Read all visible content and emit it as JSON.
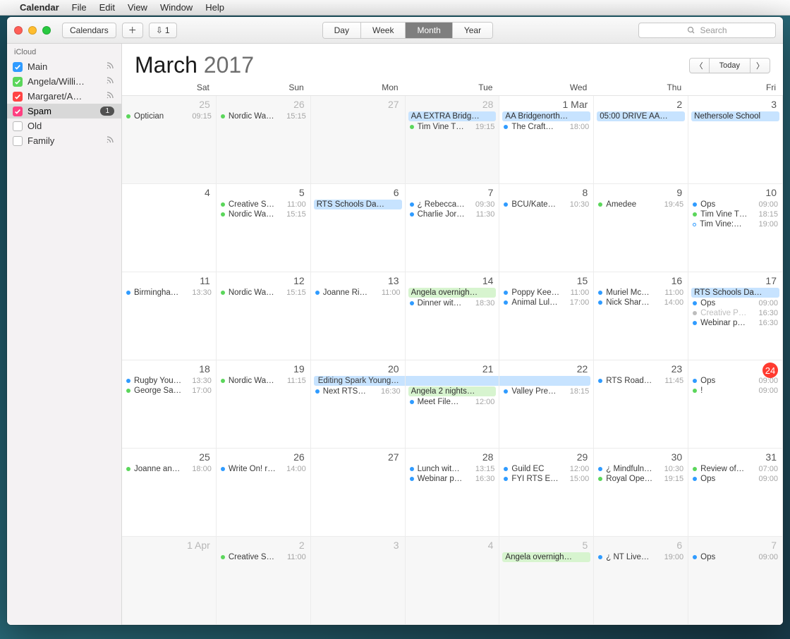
{
  "menubar": {
    "appname": "Calendar",
    "items": [
      "File",
      "Edit",
      "View",
      "Window",
      "Help"
    ]
  },
  "toolbar": {
    "calendars_label": "Calendars",
    "inbox_count": "1",
    "views": [
      "Day",
      "Week",
      "Month",
      "Year"
    ],
    "active_view": "Month",
    "search_placeholder": "Search"
  },
  "sidebar": {
    "section": "iCloud",
    "items": [
      {
        "label": "Main",
        "color": "#2f9bff",
        "checked": true,
        "rss": true
      },
      {
        "label": "Angela/Willi…",
        "color": "#5bd65b",
        "checked": true,
        "rss": true
      },
      {
        "label": "Margaret/A…",
        "color": "#ff4444",
        "checked": true,
        "rss": true
      },
      {
        "label": "Spam",
        "color": "#ff4081",
        "checked": true,
        "badge": "1",
        "selected": true
      },
      {
        "label": "Old",
        "color": "#2f9bff",
        "checked": false
      },
      {
        "label": "Family",
        "color": "#ffb100",
        "checked": false,
        "rss": true
      }
    ]
  },
  "header": {
    "month": "March",
    "year": "2017",
    "today_label": "Today"
  },
  "daynames": [
    "Sat",
    "Sun",
    "Mon",
    "Tue",
    "Wed",
    "Thu",
    "Fri"
  ],
  "colors": {
    "blue": "#2f9bff",
    "green": "#5bd65b",
    "blockBlue": "#c7e3ff",
    "blockGreen": "#d7f4cf",
    "grey": "#bdbdbd"
  },
  "cells": [
    {
      "label": "25",
      "off": true,
      "events": [
        {
          "type": "dot",
          "color": "green",
          "title": "Optician",
          "time": "09:15"
        }
      ]
    },
    {
      "label": "26",
      "off": true,
      "events": [
        {
          "type": "dot",
          "color": "green",
          "title": "Nordic Wa…",
          "time": "15:15"
        }
      ]
    },
    {
      "label": "27",
      "off": true,
      "events": []
    },
    {
      "label": "28",
      "off": true,
      "events": [
        {
          "type": "block",
          "bg": "blockBlue",
          "title": "AA EXTRA Bridg…"
        },
        {
          "type": "dot",
          "color": "green",
          "title": "Tim Vine T…",
          "time": "19:15"
        }
      ]
    },
    {
      "label": "1 Mar",
      "events": [
        {
          "type": "block",
          "bg": "blockBlue",
          "title": "AA Bridgenorth…"
        },
        {
          "type": "dot",
          "color": "blue",
          "title": "The Craft…",
          "time": "18:00"
        }
      ]
    },
    {
      "label": "2",
      "events": [
        {
          "type": "block",
          "bg": "blockBlue",
          "title": "05:00 DRIVE AA…"
        }
      ]
    },
    {
      "label": "3",
      "events": [
        {
          "type": "block",
          "bg": "blockBlue",
          "title": "Nethersole School"
        }
      ]
    },
    {
      "label": "4",
      "events": []
    },
    {
      "label": "5",
      "events": [
        {
          "type": "dot",
          "color": "green",
          "title": "Creative S…",
          "time": "11:00"
        },
        {
          "type": "dot",
          "color": "green",
          "title": "Nordic Wa…",
          "time": "15:15"
        }
      ]
    },
    {
      "label": "6",
      "events": [
        {
          "type": "block",
          "bg": "blockBlue",
          "title": "RTS Schools Da…"
        }
      ]
    },
    {
      "label": "7",
      "events": [
        {
          "type": "dot",
          "color": "blue",
          "title": "¿ Rebecca…",
          "time": "09:30"
        },
        {
          "type": "dot",
          "color": "blue",
          "title": "Charlie Jor…",
          "time": "11:30"
        }
      ]
    },
    {
      "label": "8",
      "events": [
        {
          "type": "dot",
          "color": "blue",
          "title": "BCU/Kate…",
          "time": "10:30"
        }
      ]
    },
    {
      "label": "9",
      "events": [
        {
          "type": "dot",
          "color": "green",
          "title": "Amedee",
          "time": "19:45"
        }
      ]
    },
    {
      "label": "10",
      "events": [
        {
          "type": "dot",
          "color": "blue",
          "title": "Ops",
          "time": "09:00"
        },
        {
          "type": "dot",
          "color": "green",
          "title": "Tim Vine T…",
          "time": "18:15"
        },
        {
          "type": "dot",
          "color": "blue",
          "hollow": true,
          "title": "Tim Vine:…",
          "time": "19:00"
        }
      ]
    },
    {
      "label": "11",
      "events": [
        {
          "type": "dot",
          "color": "blue",
          "title": "Birmingha…",
          "time": "13:30"
        }
      ]
    },
    {
      "label": "12",
      "events": [
        {
          "type": "dot",
          "color": "green",
          "title": "Nordic Wa…",
          "time": "15:15"
        }
      ]
    },
    {
      "label": "13",
      "events": [
        {
          "type": "dot",
          "color": "blue",
          "title": "Joanne Ri…",
          "time": "11:00"
        }
      ]
    },
    {
      "label": "14",
      "events": [
        {
          "type": "block",
          "bg": "blockGreen",
          "title": "Angela overnigh…"
        },
        {
          "type": "dot",
          "color": "blue",
          "title": "Dinner wit…",
          "time": "18:30"
        }
      ]
    },
    {
      "label": "15",
      "events": [
        {
          "type": "dot",
          "color": "blue",
          "title": "Poppy Kee…",
          "time": "11:00"
        },
        {
          "type": "dot",
          "color": "blue",
          "title": "Animal Lul…",
          "time": "17:00"
        }
      ]
    },
    {
      "label": "16",
      "events": [
        {
          "type": "dot",
          "color": "blue",
          "title": "Muriel Mc…",
          "time": "11:00"
        },
        {
          "type": "dot",
          "color": "blue",
          "title": "Nick Shar…",
          "time": "14:00"
        }
      ]
    },
    {
      "label": "17",
      "events": [
        {
          "type": "block",
          "bg": "blockBlue",
          "title": "RTS Schools Da…"
        },
        {
          "type": "dot",
          "color": "blue",
          "title": "Ops",
          "time": "09:00"
        },
        {
          "type": "dot",
          "color": "grey",
          "dimmed": true,
          "title": "Creative P…",
          "time": "16:30"
        },
        {
          "type": "dot",
          "color": "blue",
          "title": "Webinar p…",
          "time": "16:30"
        }
      ]
    },
    {
      "label": "18",
      "events": [
        {
          "type": "dot",
          "color": "blue",
          "title": "Rugby You…",
          "time": "13:30"
        },
        {
          "type": "dot",
          "color": "green",
          "title": "George Sa…",
          "time": "17:00"
        }
      ]
    },
    {
      "label": "19",
      "events": [
        {
          "type": "dot",
          "color": "green",
          "title": "Nordic Wa…",
          "time": "11:15"
        }
      ]
    },
    {
      "label": "20",
      "events": [
        {
          "type": "span",
          "bg": "blockBlue",
          "span": "start",
          "title": "Editing Spark Young Writers magazine"
        },
        {
          "type": "dot",
          "color": "blue",
          "title": "Next RTS…",
          "time": "16:30"
        }
      ]
    },
    {
      "label": "21",
      "events": [
        {
          "type": "span",
          "bg": "blockBlue",
          "span": "mid",
          "title": "."
        },
        {
          "type": "block",
          "bg": "blockGreen",
          "title": "Angela 2 nights…"
        },
        {
          "type": "dot",
          "color": "blue",
          "title": "Meet File…",
          "time": "12:00"
        }
      ]
    },
    {
      "label": "22",
      "events": [
        {
          "type": "span",
          "bg": "blockBlue",
          "span": "end",
          "title": "."
        },
        {
          "type": "dot",
          "color": "blue",
          "title": "Valley Pre…",
          "time": "18:15"
        }
      ]
    },
    {
      "label": "23",
      "events": [
        {
          "type": "dot",
          "color": "blue",
          "title": "RTS Road…",
          "time": "11:45"
        }
      ]
    },
    {
      "label": "24",
      "today": true,
      "events": [
        {
          "type": "dot",
          "color": "blue",
          "title": "Ops",
          "time": "09:00"
        },
        {
          "type": "dot",
          "color": "green",
          "title": "!",
          "time": "09:00"
        }
      ]
    },
    {
      "label": "25",
      "events": [
        {
          "type": "dot",
          "color": "green",
          "title": "Joanne an…",
          "time": "18:00"
        }
      ]
    },
    {
      "label": "26",
      "events": [
        {
          "type": "dot",
          "color": "blue",
          "title": "Write On! r…",
          "time": "14:00"
        }
      ]
    },
    {
      "label": "27",
      "events": []
    },
    {
      "label": "28",
      "events": [
        {
          "type": "dot",
          "color": "blue",
          "title": "Lunch wit…",
          "time": "13:15"
        },
        {
          "type": "dot",
          "color": "blue",
          "title": "Webinar p…",
          "time": "16:30"
        }
      ]
    },
    {
      "label": "29",
      "events": [
        {
          "type": "dot",
          "color": "blue",
          "title": "Guild EC",
          "time": "12:00"
        },
        {
          "type": "dot",
          "color": "blue",
          "title": "FYI RTS E…",
          "time": "15:00"
        }
      ]
    },
    {
      "label": "30",
      "events": [
        {
          "type": "dot",
          "color": "blue",
          "title": "¿ Mindfuln…",
          "time": "10:30"
        },
        {
          "type": "dot",
          "color": "green",
          "title": "Royal Ope…",
          "time": "19:15"
        }
      ]
    },
    {
      "label": "31",
      "events": [
        {
          "type": "dot",
          "color": "green",
          "title": "Review of…",
          "time": "07:00"
        },
        {
          "type": "dot",
          "color": "blue",
          "title": "Ops",
          "time": "09:00"
        }
      ]
    },
    {
      "label": "1 Apr",
      "off": true,
      "events": []
    },
    {
      "label": "2",
      "off": true,
      "events": [
        {
          "type": "dot",
          "color": "green",
          "title": "Creative S…",
          "time": "11:00"
        }
      ]
    },
    {
      "label": "3",
      "off": true,
      "events": []
    },
    {
      "label": "4",
      "off": true,
      "events": []
    },
    {
      "label": "5",
      "off": true,
      "events": [
        {
          "type": "block",
          "bg": "blockGreen",
          "title": "Angela overnigh…"
        }
      ]
    },
    {
      "label": "6",
      "off": true,
      "events": [
        {
          "type": "dot",
          "color": "blue",
          "title": "¿ NT Live…",
          "time": "19:00"
        }
      ]
    },
    {
      "label": "7",
      "off": true,
      "events": [
        {
          "type": "dot",
          "color": "blue",
          "title": "Ops",
          "time": "09:00"
        }
      ]
    }
  ]
}
